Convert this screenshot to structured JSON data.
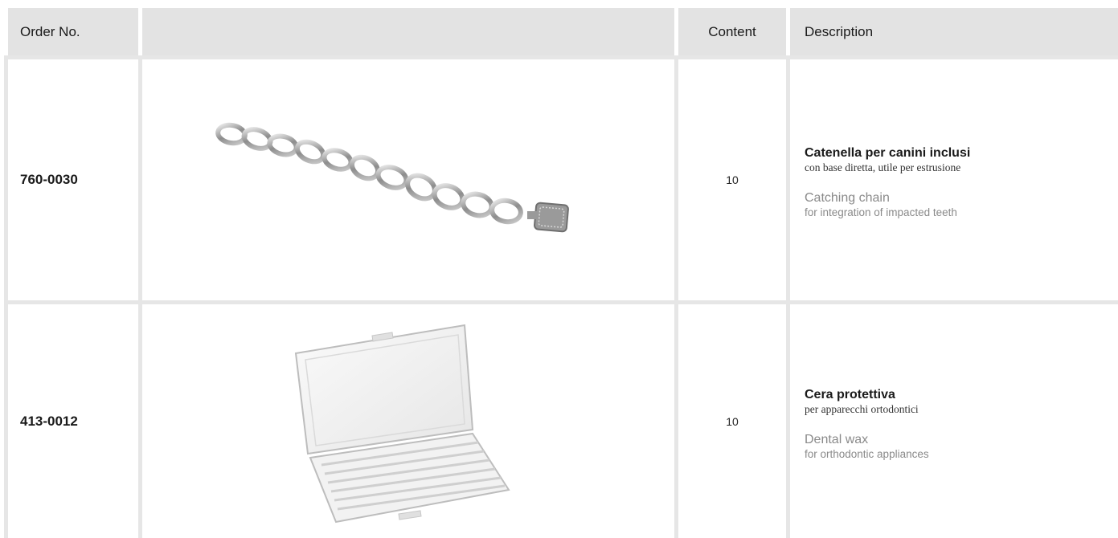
{
  "headers": {
    "order_no": "Order No.",
    "image": "",
    "content": "Content",
    "description": "Description"
  },
  "rows": [
    {
      "order_no": "760-0030",
      "image_icon": "catching-chain-photo",
      "content": "10",
      "title_it": "Catenella per canini inclusi",
      "subtitle_it": "con base diretta, utile per estrusione",
      "title_en": "Catching chain",
      "subtitle_en": "for integration of impacted teeth"
    },
    {
      "order_no": "413-0012",
      "image_icon": "dental-wax-case-photo",
      "content": "10",
      "title_it": "Cera protettiva",
      "subtitle_it": "per apparecchi ortodontici",
      "title_en": "Dental wax",
      "subtitle_en": "for orthodontic appliances"
    }
  ]
}
